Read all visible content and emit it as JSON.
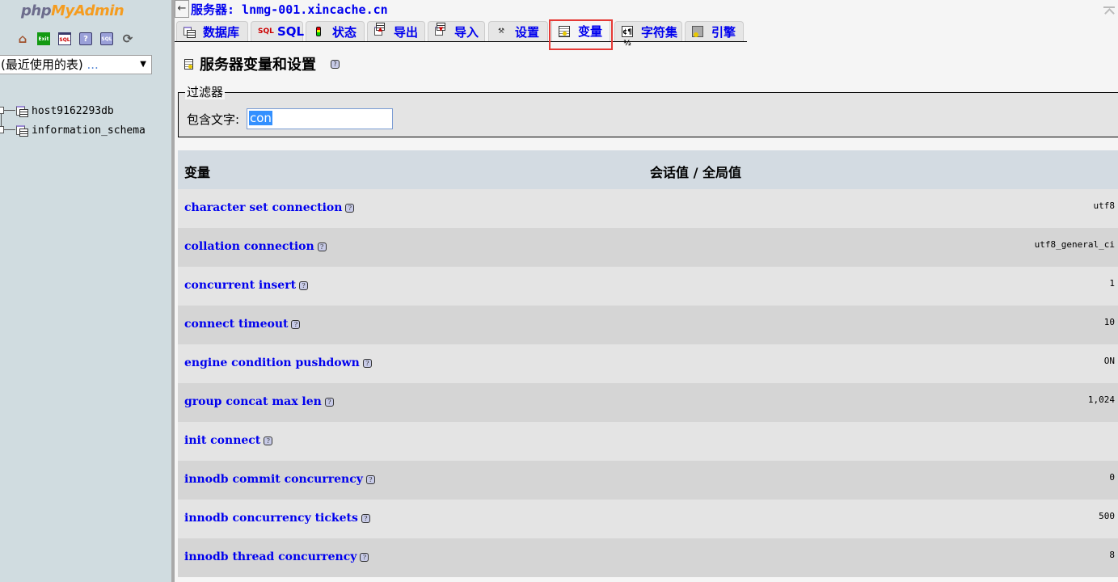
{
  "nav": {
    "logo_php": "php",
    "logo_myadmin": "MyAdmin",
    "icons": [
      "home-icon",
      "exit-icon",
      "sql-query-window-icon",
      "documentation-icon",
      "sql-docs-icon",
      "reload-icon"
    ],
    "icon_glyphs": {
      "home": "⌂",
      "exit": "Exit\n→",
      "sql": "SQL",
      "help": "?",
      "sqlq": "SQL",
      "reload": "⟳"
    },
    "recent_tables": {
      "label": "(最近使用的表)",
      "suffix": " ...",
      "arrow": "▼"
    },
    "databases": [
      {
        "name": "host9162293db"
      },
      {
        "name": "information_schema"
      }
    ]
  },
  "header": {
    "collapse_glyph": "←",
    "server_label": "服务器: lnmg-001.xincache.cn"
  },
  "tabs": [
    {
      "label": "数据库",
      "icon": "database-icon",
      "active": false
    },
    {
      "label": "SQL",
      "icon": "sql-icon",
      "active": false
    },
    {
      "label": "状态",
      "icon": "status-traffic-light-icon",
      "active": false
    },
    {
      "label": "导出",
      "icon": "export-icon",
      "active": false
    },
    {
      "label": "导入",
      "icon": "import-icon",
      "active": false
    },
    {
      "label": "设置",
      "icon": "settings-tools-icon",
      "active": false
    },
    {
      "label": "变量",
      "icon": "variables-icon",
      "active": true
    },
    {
      "label": "字符集",
      "icon": "charset-icon",
      "active": false
    },
    {
      "label": "引擎",
      "icon": "engine-icon",
      "active": false
    }
  ],
  "page": {
    "title": "服务器变量和设置",
    "help_glyph": "?"
  },
  "filter": {
    "legend": "过滤器",
    "label": "包含文字:",
    "value": "con"
  },
  "table": {
    "col_variable": "变量",
    "col_value": "会话值 / 全局值",
    "rows": [
      {
        "name": "character set connection",
        "value": "utf8"
      },
      {
        "name": "collation connection",
        "value": "utf8_general_ci"
      },
      {
        "name": "concurrent insert",
        "value": "1"
      },
      {
        "name": "connect timeout",
        "value": "10"
      },
      {
        "name": "engine condition pushdown",
        "value": "ON"
      },
      {
        "name": "group concat max len",
        "value": "1,024"
      },
      {
        "name": "init connect",
        "value": ""
      },
      {
        "name": "innodb commit concurrency",
        "value": "0"
      },
      {
        "name": "innodb concurrency tickets",
        "value": "500"
      },
      {
        "name": "innodb thread concurrency",
        "value": "8"
      }
    ]
  },
  "annotation": {
    "highlight_color": "#e53935",
    "highlighted_tab": "变量"
  }
}
